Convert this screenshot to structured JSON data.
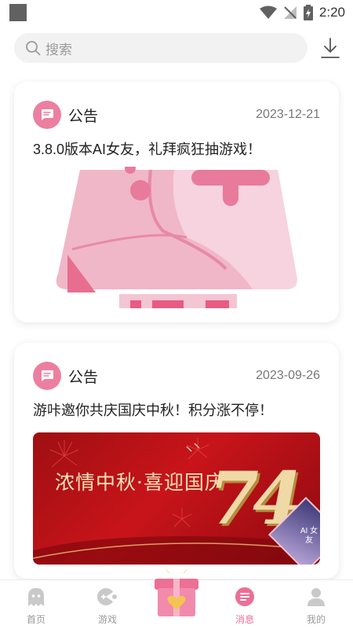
{
  "status_bar": {
    "time": "2:20"
  },
  "search": {
    "placeholder": "搜索"
  },
  "feed": [
    {
      "tag": "公告",
      "date": "2023-12-21",
      "title": "3.8.0版本AI女友，礼拜疯狂抽游戏！"
    },
    {
      "tag": "公告",
      "date": "2023-09-26",
      "title": "游咔邀你共庆国庆中秋！积分涨不停！"
    }
  ],
  "banner2": {
    "headline": "浓情中秋·喜迎国庆",
    "number": "74",
    "badge": "AI 女友"
  },
  "tabs": [
    {
      "label": "首页",
      "icon": "ghost-icon",
      "active": false
    },
    {
      "label": "游戏",
      "icon": "gamepad-icon",
      "active": false
    },
    {
      "label": "消息",
      "icon": "message-icon",
      "active": true
    },
    {
      "label": "我的",
      "icon": "user-icon",
      "active": false
    }
  ],
  "colors": {
    "accent": "#ec7fa0",
    "active_tab": "#ec6f95",
    "banner_red": "#c8141a"
  }
}
